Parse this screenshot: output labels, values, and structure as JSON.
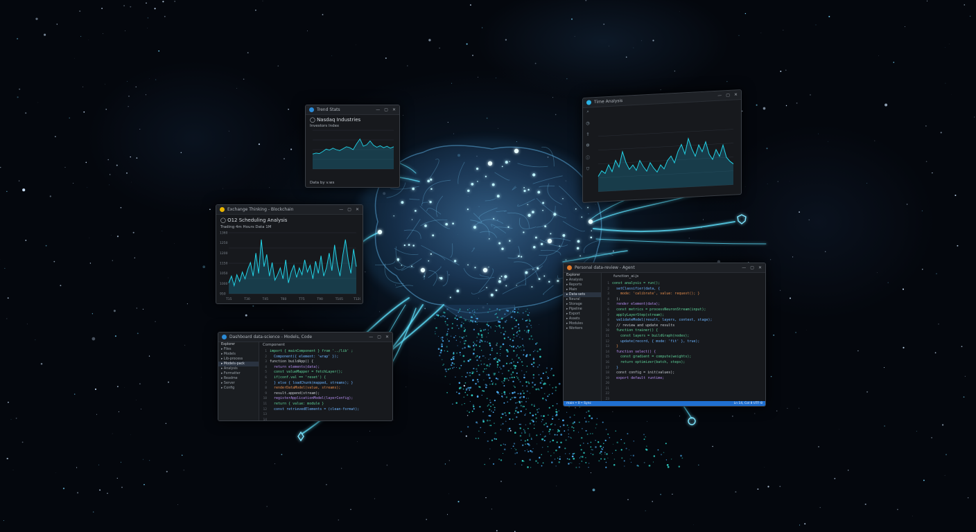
{
  "colors": {
    "background": "#04070d",
    "brain_glow": "#5fe3ff",
    "chart_line": "#22d3e6",
    "window_bg": "#17191d",
    "status_blue": "#1f6fd0",
    "code_green": "#5fd39a",
    "code_orange": "#e08a4a",
    "code_blue": "#6cb4ff"
  },
  "icons": {
    "central": "glowing-brain-network",
    "tendrils": "light-filaments",
    "nodes": "glowing-endpoint-icons"
  },
  "windows": {
    "chart_small": {
      "title": "Trend Stats",
      "heading": "Nasdaq Industries",
      "subheading": "Investors Index",
      "footer": "Data by v.ws"
    },
    "chart_large": {
      "title": "Exchange Thinking - Blockchain",
      "heading": "O12 Scheduling Analysis",
      "toolbar_text": "Trading 4m Hours   Data 1M",
      "y_ticks": [
        "1360",
        "1250",
        "1200",
        "1150",
        "1050",
        "1000",
        "950"
      ],
      "x_ticks": [
        "T15",
        "T30",
        "T45",
        "T60",
        "T75",
        "T90",
        "T105",
        "T120"
      ]
    },
    "chart_right": {
      "title": "Time Analysis",
      "toolbar_items": [
        "search",
        "history",
        "share",
        "settings",
        "info",
        "shield"
      ]
    },
    "code_left": {
      "title": "Dashboard data-science - Models, Code",
      "sidebar_header": "Explorer",
      "sidebar_items": [
        "Files",
        "Models",
        "Lib-process",
        "Models-pack",
        "Analysis",
        "Formatter",
        "Readme",
        "Server",
        "Config"
      ],
      "tab": "Component",
      "lines": [
        "import { mainComponent } from '../lib' ;",
        "  Component({ element: 'wrap' });",
        "",
        "function buildApp() {",
        "  return elements(data);",
        "  const valueMapper = fetchLayer();",
        "  if(conf.val == 'reset') {",
        "  } else { loadChunk(mapped, streams); }",
        "  renderDataModel(value, streams);",
        "  result.append(stream);",
        "  registerApplicationModel(layerConfig);",
        "",
        "  return { value: module }",
        "  const retrievedElements = (clean-format);"
      ]
    },
    "code_right": {
      "title": "Personal data-review - Agent",
      "sidebar_header": "Explorer",
      "sidebar_items": [
        "Analysis",
        "Reports",
        "Main",
        "Data-sets",
        "Neural",
        "Storage",
        "Pipeline",
        "Export",
        "Assets",
        "Modules",
        "Workers"
      ],
      "tab": "function_ai.js",
      "status_left": "main • 0 • Sync",
      "status_right": "Ln 14, Col 8   UTF-8",
      "lines": [
        "const analysis = run();",
        "  setClassifier(data, {",
        "    mode: 'calibrate', value: request(); }",
        "  );",
        "  render element(data);",
        "  const metrics = processNeuronStream(input);",
        "  applyLayerStep(stream);",
        "  validateModel(result, layers, context, stage);",
        "",
        "  // review and update results",
        "",
        "  function trainer() {",
        "    const layers = buildGraph(nodes);",
        "    update(record, { mode: 'fit' }, true);",
        "  }",
        "",
        "  function select() {",
        "    const gradient = compute(weights);",
        "    return optimizer(batch, steps);",
        "  }",
        "",
        "  const config = init(values);",
        "  export default runtime;"
      ]
    }
  },
  "chart_data": [
    {
      "type": "area",
      "id": "chart_small",
      "x": [
        0,
        1,
        2,
        3,
        4,
        5,
        6,
        7,
        8,
        9,
        10,
        11,
        12,
        13,
        14,
        15,
        16,
        17,
        18,
        19,
        20,
        21,
        22,
        23,
        24
      ],
      "series": [
        {
          "values": [
            31,
            33,
            32,
            36,
            41,
            39,
            43,
            40,
            38,
            42,
            46,
            44,
            40,
            52,
            62,
            47,
            50,
            58,
            49,
            45,
            48,
            44,
            47,
            43,
            46
          ]
        }
      ],
      "ylim": [
        0,
        80
      ]
    },
    {
      "type": "area",
      "id": "chart_large",
      "x": [
        0,
        1,
        2,
        3,
        4,
        5,
        6,
        7,
        8,
        9,
        10,
        11,
        12,
        13,
        14,
        15,
        16,
        17,
        18,
        19,
        20,
        21,
        22,
        23,
        24,
        25,
        26,
        27,
        28,
        29,
        30,
        31,
        32,
        33,
        34,
        35,
        36,
        37,
        38,
        39,
        40,
        41,
        42,
        43,
        44,
        45,
        46,
        47
      ],
      "series": [
        {
          "values": [
            1030,
            1080,
            1010,
            1090,
            1040,
            1110,
            1060,
            1130,
            1180,
            1080,
            1250,
            1100,
            1350,
            1150,
            1240,
            1080,
            1180,
            1050,
            1090,
            1140,
            1060,
            1200,
            1030,
            1110,
            1160,
            1070,
            1140,
            1090,
            1200,
            1110,
            1160,
            1060,
            1190,
            1100,
            1230,
            1080,
            1140,
            1250,
            1120,
            1310,
            1170,
            1080,
            1230,
            1350,
            1200,
            1100,
            1280,
            1150
          ]
        }
      ],
      "ylim": [
        950,
        1400
      ]
    },
    {
      "type": "area",
      "id": "chart_right",
      "x": [
        0,
        1,
        2,
        3,
        4,
        5,
        6,
        7,
        8,
        9,
        10,
        11,
        12,
        13,
        14,
        15,
        16,
        17,
        18,
        19,
        20,
        21,
        22,
        23,
        24,
        25,
        26,
        27,
        28,
        29,
        30,
        31,
        32,
        33,
        34,
        35,
        36,
        37,
        38,
        39
      ],
      "series": [
        {
          "values": [
            22,
            30,
            26,
            38,
            28,
            44,
            34,
            56,
            40,
            30,
            36,
            28,
            42,
            33,
            26,
            38,
            30,
            24,
            34,
            28,
            40,
            46,
            36,
            52,
            62,
            48,
            70,
            55,
            44,
            60,
            50,
            64,
            46,
            38,
            52,
            42,
            58,
            40,
            34,
            30
          ]
        }
      ],
      "ylim": [
        0,
        80
      ]
    }
  ]
}
